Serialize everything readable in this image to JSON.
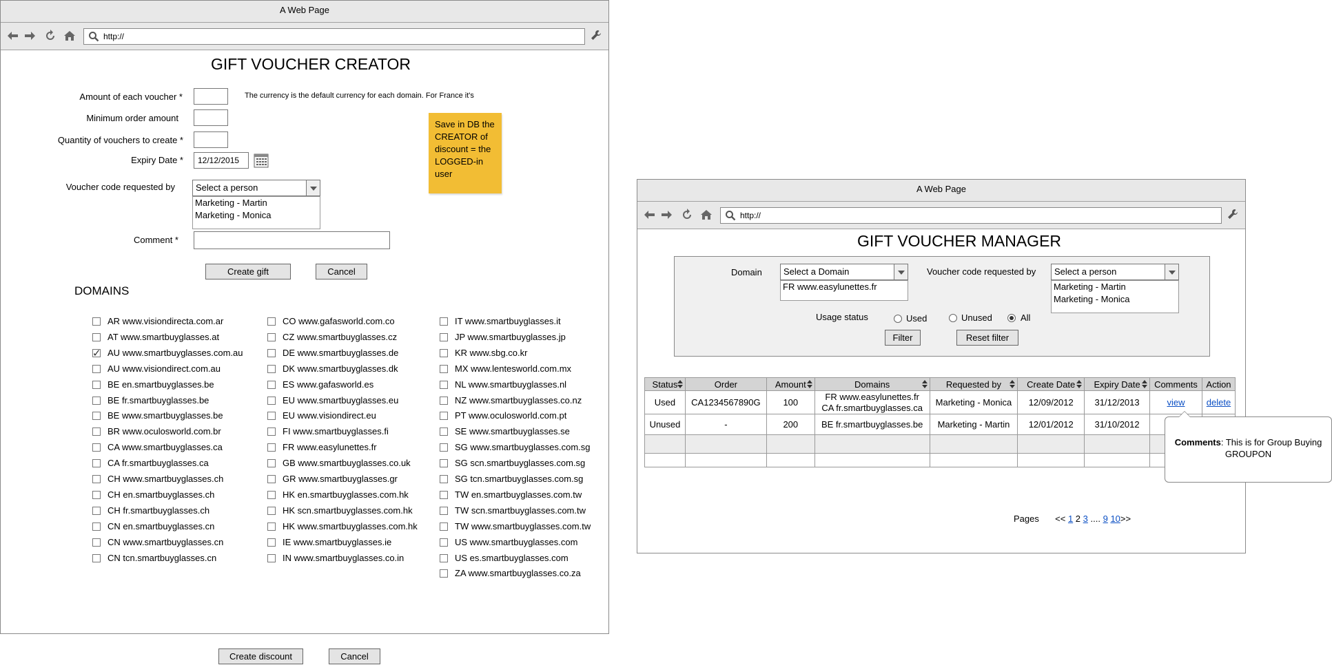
{
  "creator": {
    "window_title": "A Web Page",
    "url": "http://",
    "heading": "GIFT VOUCHER CREATOR",
    "fields": {
      "amount_label": "Amount of each voucher *",
      "amount_value": "",
      "currency_note": "The currency is the default currency for each domain. For France it's",
      "min_order_label": "Minimum order amount",
      "min_order_value": "",
      "quantity_label": "Quantity of vouchers to create *",
      "quantity_value": "",
      "expiry_label": "Expiry Date *",
      "expiry_value": "12/12/2015",
      "requested_by_label": "Voucher code requested by",
      "requested_by_selected": "Select a person",
      "requested_by_options": [
        "Marketing - Martin",
        "Marketing - Monica"
      ],
      "comment_label": "Comment *",
      "comment_value": ""
    },
    "note": "Save in DB the CREATOR of discount = the LOGGED-in user",
    "note_color": "#f2bd34",
    "create_gift_label": "Create gift",
    "cancel_label": "Cancel",
    "domains_heading": "DOMAINS",
    "domains": {
      "col1": [
        {
          "label": "AR www.visiondirecta.com.ar",
          "checked": false
        },
        {
          "label": "AT www.smartbuyglasses.at",
          "checked": false
        },
        {
          "label": "AU www.smartbuyglasses.com.au",
          "checked": true
        },
        {
          "label": "AU www.visiondirect.com.au",
          "checked": false
        },
        {
          "label": "BE en.smartbuyglasses.be",
          "checked": false
        },
        {
          "label": "BE fr.smartbuyglasses.be",
          "checked": false
        },
        {
          "label": "BE www.smartbuyglasses.be",
          "checked": false
        },
        {
          "label": "BR www.oculosworld.com.br",
          "checked": false
        },
        {
          "label": "CA www.smartbuyglasses.ca",
          "checked": false
        },
        {
          "label": "CA fr.smartbuyglasses.ca",
          "checked": false
        },
        {
          "label": "CH www.smartbuyglasses.ch",
          "checked": false
        },
        {
          "label": "CH en.smartbuyglasses.ch",
          "checked": false
        },
        {
          "label": "CH fr.smartbuyglasses.ch",
          "checked": false
        },
        {
          "label": "CN en.smartbuyglasses.cn",
          "checked": false
        },
        {
          "label": "CN www.smartbuyglasses.cn",
          "checked": false
        },
        {
          "label": "CN tcn.smartbuyglasses.cn",
          "checked": false
        }
      ],
      "col2": [
        {
          "label": "CO www.gafasworld.com.co",
          "checked": false
        },
        {
          "label": "CZ www.smartbuyglasses.cz",
          "checked": false
        },
        {
          "label": "DE www.smartbuyglasses.de",
          "checked": false
        },
        {
          "label": "DK www.smartbuyglasses.dk",
          "checked": false
        },
        {
          "label": "ES www.gafasworld.es",
          "checked": false
        },
        {
          "label": "EU www.smartbuyglasses.eu",
          "checked": false
        },
        {
          "label": "EU www.visiondirect.eu",
          "checked": false
        },
        {
          "label": "FI www.smartbuyglasses.fi",
          "checked": false
        },
        {
          "label": "FR www.easylunettes.fr",
          "checked": false
        },
        {
          "label": "GB www.smartbuyglasses.co.uk",
          "checked": false
        },
        {
          "label": "GR www.smartbuyglasses.gr",
          "checked": false
        },
        {
          "label": "HK en.smartbuyglasses.com.hk",
          "checked": false
        },
        {
          "label": "HK scn.smartbuyglasses.com.hk",
          "checked": false
        },
        {
          "label": "HK www.smartbuyglasses.com.hk",
          "checked": false
        },
        {
          "label": "IE www.smartbuyglasses.ie",
          "checked": false
        },
        {
          "label": "IN www.smartbuyglasses.co.in",
          "checked": false
        }
      ],
      "col3": [
        {
          "label": "IT www.smartbuyglasses.it",
          "checked": false
        },
        {
          "label": "JP www.smartbuyglasses.jp",
          "checked": false
        },
        {
          "label": "KR www.sbg.co.kr",
          "checked": false
        },
        {
          "label": "MX www.lentesworld.com.mx",
          "checked": false
        },
        {
          "label": "NL www.smartbuyglasses.nl",
          "checked": false
        },
        {
          "label": "NZ www.smartbuyglasses.co.nz",
          "checked": false
        },
        {
          "label": "PT www.oculosworld.com.pt",
          "checked": false
        },
        {
          "label": "SE www.smartbuyglasses.se",
          "checked": false
        },
        {
          "label": "SG www.smartbuyglasses.com.sg",
          "checked": false
        },
        {
          "label": "SG scn.smartbuyglasses.com.sg",
          "checked": false
        },
        {
          "label": "SG tcn.smartbuyglasses.com.sg",
          "checked": false
        },
        {
          "label": "TW en.smartbuyglasses.com.tw",
          "checked": false
        },
        {
          "label": "TW scn.smartbuyglasses.com.tw",
          "checked": false
        },
        {
          "label": "TW www.smartbuyglasses.com.tw",
          "checked": false
        },
        {
          "label": "US www.smartbuyglasses.com",
          "checked": false
        },
        {
          "label": "US es.smartbuyglasses.com",
          "checked": false
        },
        {
          "label": "ZA www.smartbuyglasses.co.za",
          "checked": false
        }
      ]
    },
    "create_discount_label": "Create discount",
    "cancel2_label": "Cancel"
  },
  "manager": {
    "window_title": "A Web Page",
    "url": "http://",
    "heading": "GIFT VOUCHER MANAGER",
    "filter": {
      "domain_label": "Domain",
      "domain_selected": "Select a Domain",
      "domain_options": [
        "FR www.easylunettes.fr"
      ],
      "requested_by_label": "Voucher code requested by",
      "requested_by_selected": "Select a person",
      "requested_by_options": [
        "Marketing - Martin",
        "Marketing - Monica"
      ],
      "usage_label": "Usage status",
      "usage_options": [
        {
          "label": "Used",
          "selected": false
        },
        {
          "label": "Unused",
          "selected": false
        },
        {
          "label": "All",
          "selected": true
        }
      ],
      "filter_button": "Filter",
      "reset_button": "Reset filter"
    },
    "table": {
      "columns": [
        {
          "label": "Status",
          "sortable": true
        },
        {
          "label": "Order",
          "sortable": false
        },
        {
          "label": "Amount",
          "sortable": true
        },
        {
          "label": "Domains",
          "sortable": true
        },
        {
          "label": "Requested by",
          "sortable": true
        },
        {
          "label": "Create Date",
          "sortable": true
        },
        {
          "label": "Expiry Date",
          "sortable": true
        },
        {
          "label": "Comments",
          "sortable": false
        },
        {
          "label": "Action",
          "sortable": false
        }
      ],
      "rows": [
        {
          "status": "Used",
          "order": "CA1234567890G",
          "amount": "100",
          "domains": [
            "FR www.easylunettes.fr",
            "CA fr.smartbuyglasses.ca"
          ],
          "requested_by": "Marketing - Monica",
          "create_date": "12/09/2012",
          "expiry_date": "31/12/2013",
          "comments": "view",
          "action": "delete"
        },
        {
          "status": "Unused",
          "order": "-",
          "amount": "200",
          "domains": [
            "BE fr.smartbuyglasses.be"
          ],
          "requested_by": "Marketing - Martin",
          "create_date": "12/01/2012",
          "expiry_date": "31/10/2012",
          "comments": "",
          "action": ""
        }
      ]
    },
    "tooltip": {
      "title": "Comments",
      "text": ": This is for Group Buying GROUPON"
    },
    "pager": {
      "label": "Pages",
      "prev": "<<",
      "current": "1",
      "p2": "2",
      "p3": "3",
      "ellipsis": "....",
      "p9": "9",
      "p10": "10",
      "next": ">>"
    }
  }
}
